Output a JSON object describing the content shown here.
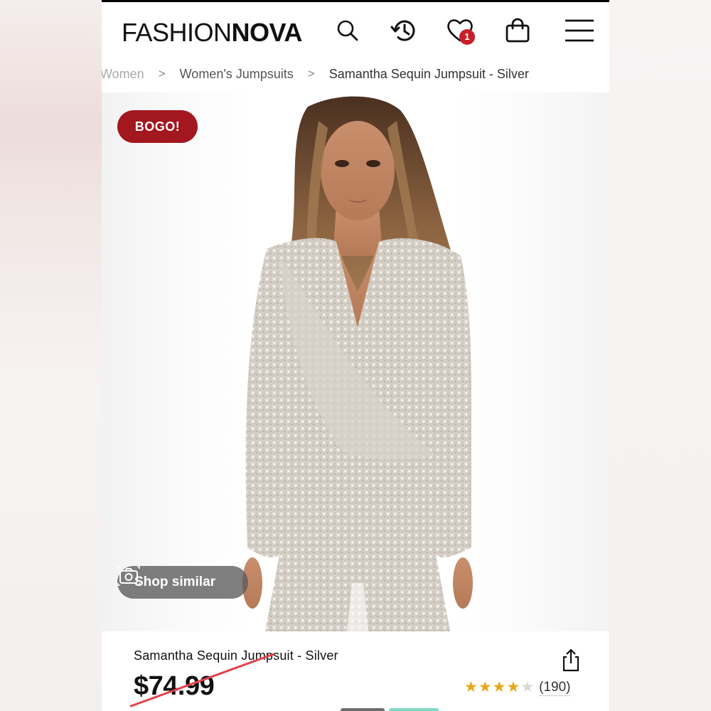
{
  "brand": {
    "logo_light": "FASHION",
    "logo_bold": "NOVA"
  },
  "header": {
    "icons": [
      "search-icon",
      "history-icon",
      "wishlist-heart-icon",
      "shopping-bag-icon",
      "menu-icon"
    ],
    "wishlist_count": "1"
  },
  "breadcrumb": {
    "items": [
      "Women",
      "Women's Jumpsuits",
      "Samantha Sequin Jumpsuit - Silver"
    ],
    "separator": ">"
  },
  "product": {
    "promo_badge": "BOGO!",
    "shop_similar_label": "Shop similar",
    "name": "Samantha Sequin Jumpsuit - Silver",
    "price": "$74.99",
    "rating_value": 4,
    "rating_max": 5,
    "review_count": "(190)"
  },
  "colors": {
    "badge_red": "#a3171f",
    "wishlist_badge": "#c8202a",
    "star_gold": "#e6a817",
    "strike_red": "#e5404a"
  }
}
